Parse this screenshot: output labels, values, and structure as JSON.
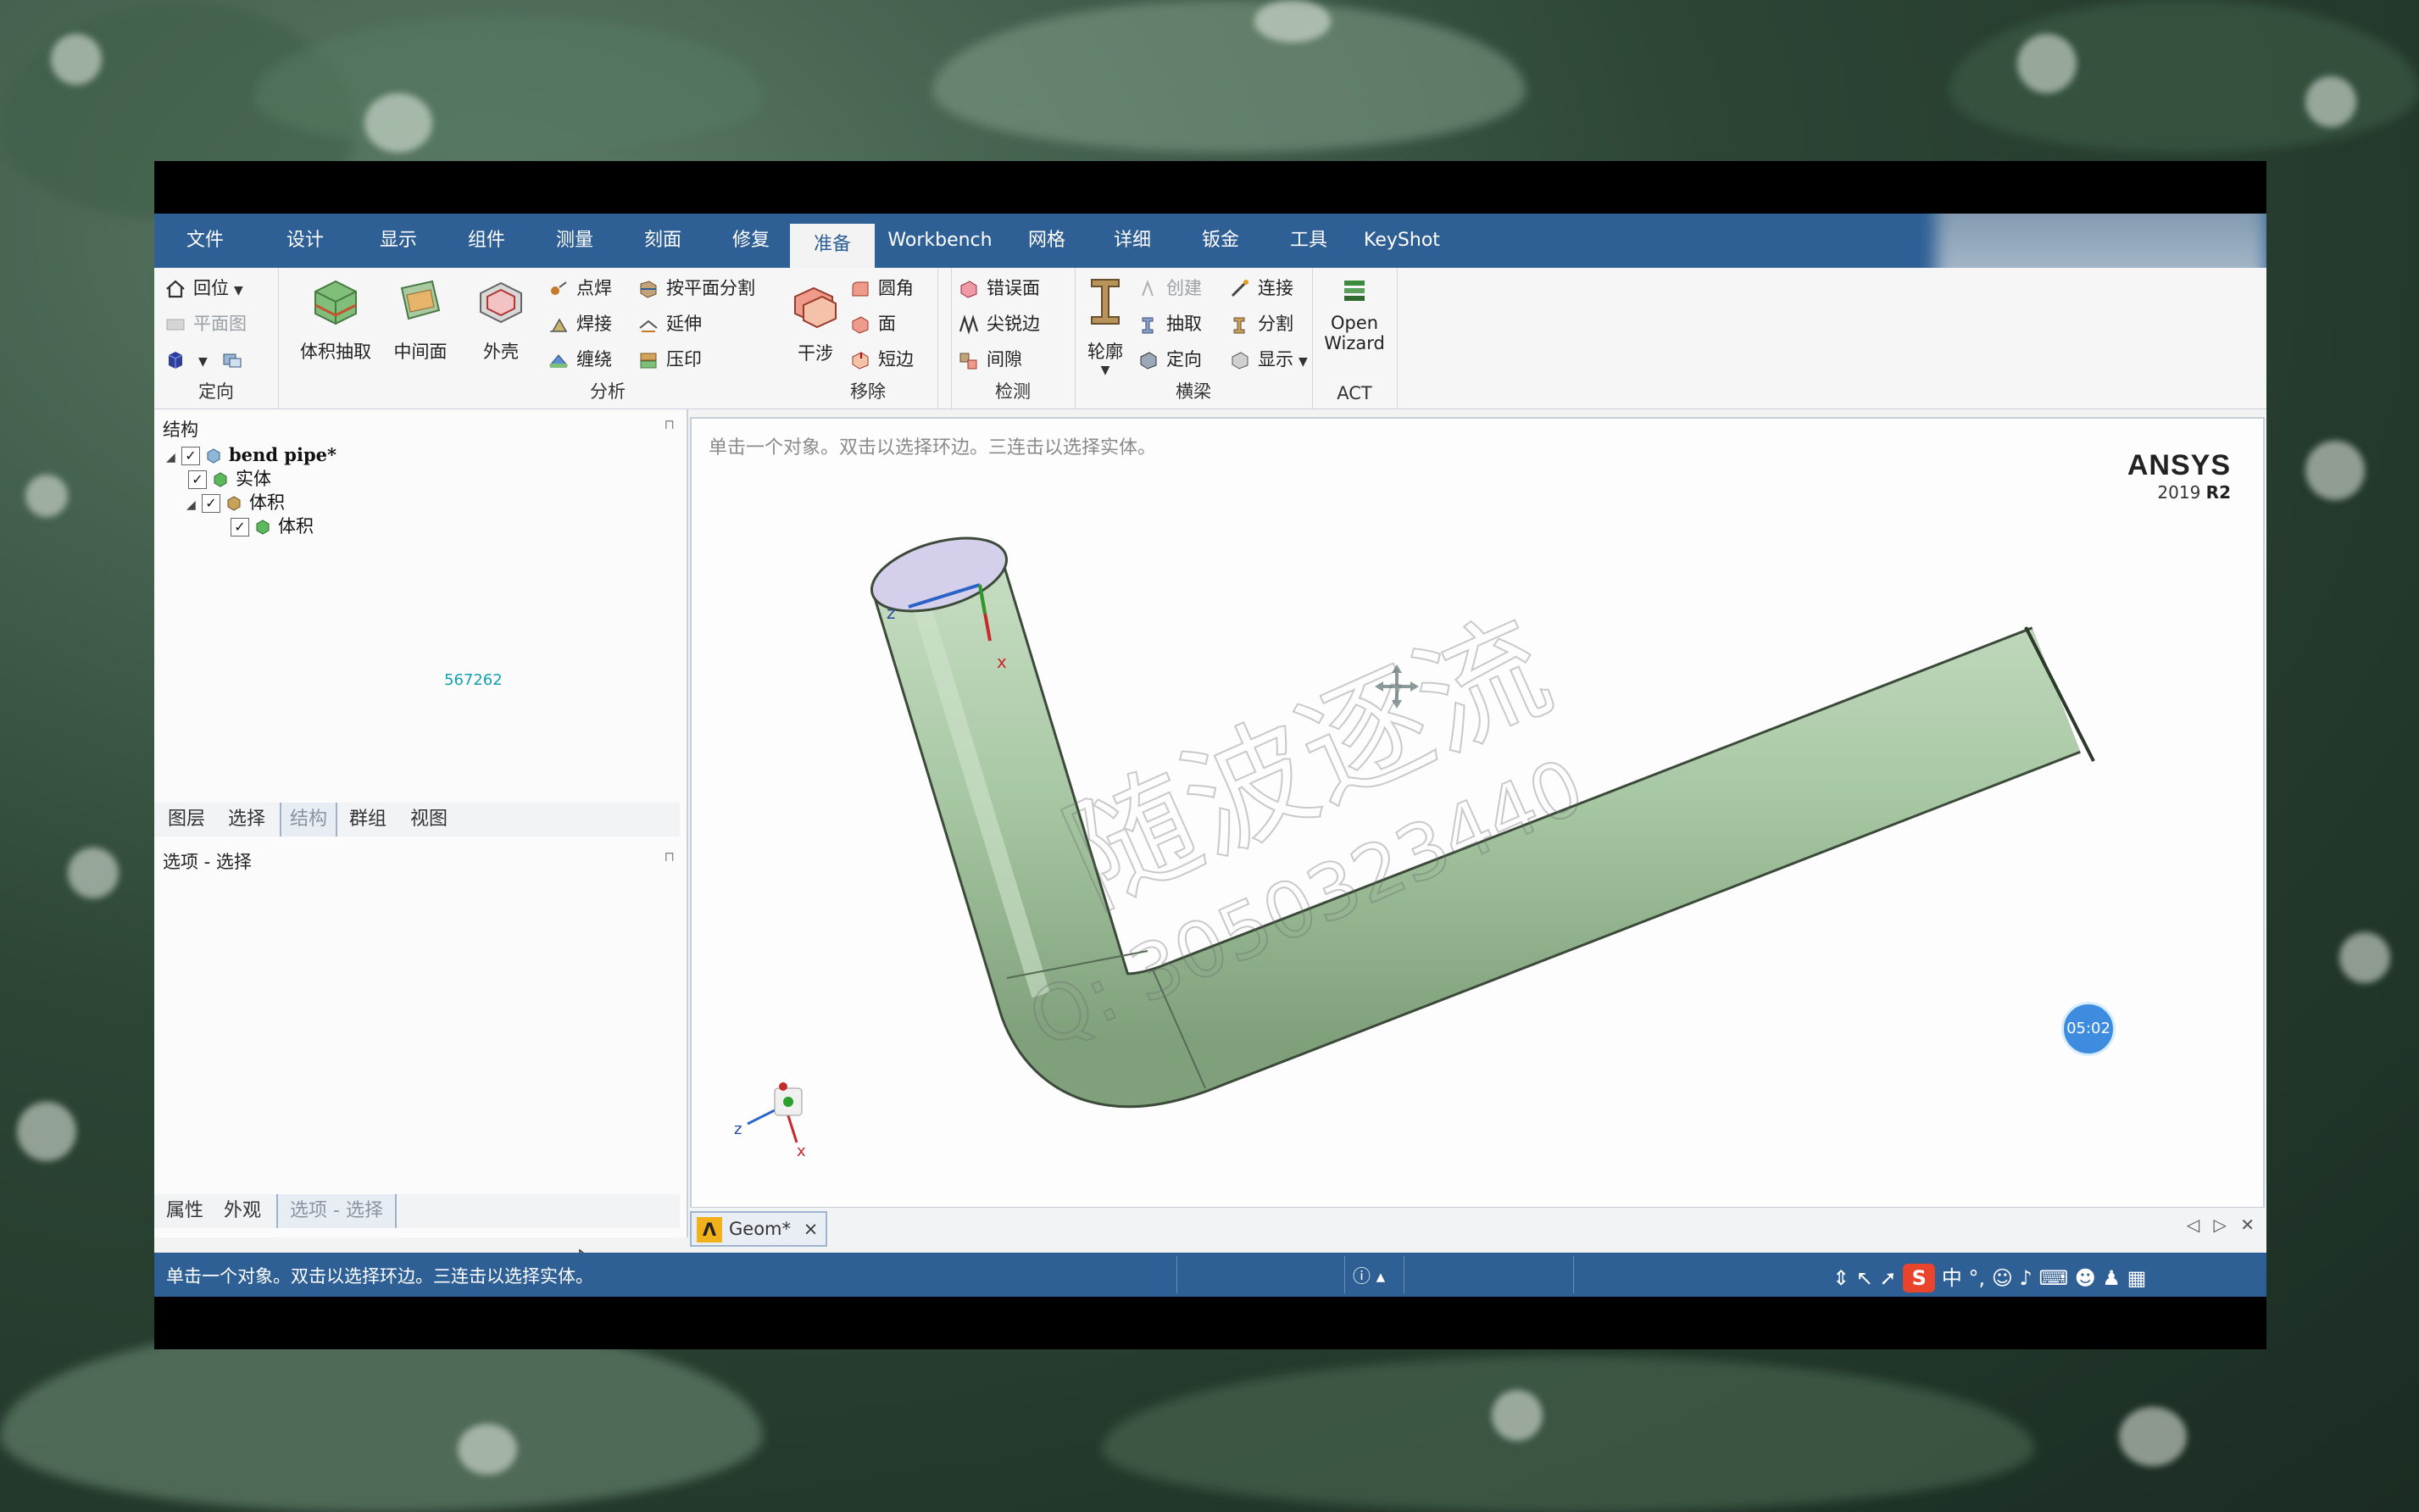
{
  "menu": {
    "tabs": [
      "文件",
      "设计",
      "显示",
      "组件",
      "测量",
      "刻面",
      "修复",
      "准备",
      "Workbench",
      "网格",
      "详细",
      "钣金",
      "工具",
      "KeyShot"
    ],
    "active_index": 7
  },
  "ribbon": {
    "orient": {
      "label": "定向",
      "restore": "回位",
      "plane": "平面图"
    },
    "analysis": {
      "label": "分析",
      "extract_volume": "体积抽取",
      "midsurface": "中间面",
      "shell": "外壳",
      "spot_weld": "点焊",
      "weld": "焊接",
      "wrap": "缠绕",
      "split_by_plane": "按平面分割",
      "extend": "延伸",
      "imprint": "压印"
    },
    "remove": {
      "label": "移除",
      "interference": "干涉",
      "round": "圆角",
      "face": "面",
      "short_edge": "短边"
    },
    "detect": {
      "label": "检测",
      "misaligned_face": "错误面",
      "sharp_edge": "尖锐边",
      "gap": "间隙"
    },
    "beam": {
      "label": "横梁",
      "profile": "轮廓",
      "create": "创建",
      "extract": "抽取",
      "orient": "定向",
      "connect": "连接",
      "split": "分割",
      "display": "显示"
    },
    "act": {
      "label": "ACT",
      "open_wizard_1": "Open",
      "open_wizard_2": "Wizard"
    }
  },
  "structure": {
    "title": "结构",
    "root": "bend pipe*",
    "solid": "实体",
    "volume_group": "体积",
    "volume_item": "体积",
    "overlay_number": "567262"
  },
  "panel_tabs": [
    "图层",
    "选择",
    "结构",
    "群组",
    "视图"
  ],
  "panel_tabs_active": 2,
  "options": {
    "title": "选项 - 选择"
  },
  "bottom_tabs": [
    "属性",
    "外观",
    "选项 - 选择"
  ],
  "bottom_tabs_active": 2,
  "viewport": {
    "hint": "单击一个对象。双击以选择环边。三连击以选择实体。",
    "brand": "ANSYS",
    "version_a": "2019",
    "version_b": "R2",
    "watermark_cn": "随波逐流",
    "watermark_q": "Q: 3050323440",
    "axis_z": "z",
    "axis_x": "x"
  },
  "doc_tab": {
    "label": "Geom*",
    "close": "×"
  },
  "timer": "05:02",
  "status": {
    "text": "单击一个对象。双击以选择环边。三连击以选择实体。"
  },
  "colors": {
    "menubar": "#2e5f95",
    "pipe": "#a9c8a6",
    "accent": "#2e5f95"
  }
}
